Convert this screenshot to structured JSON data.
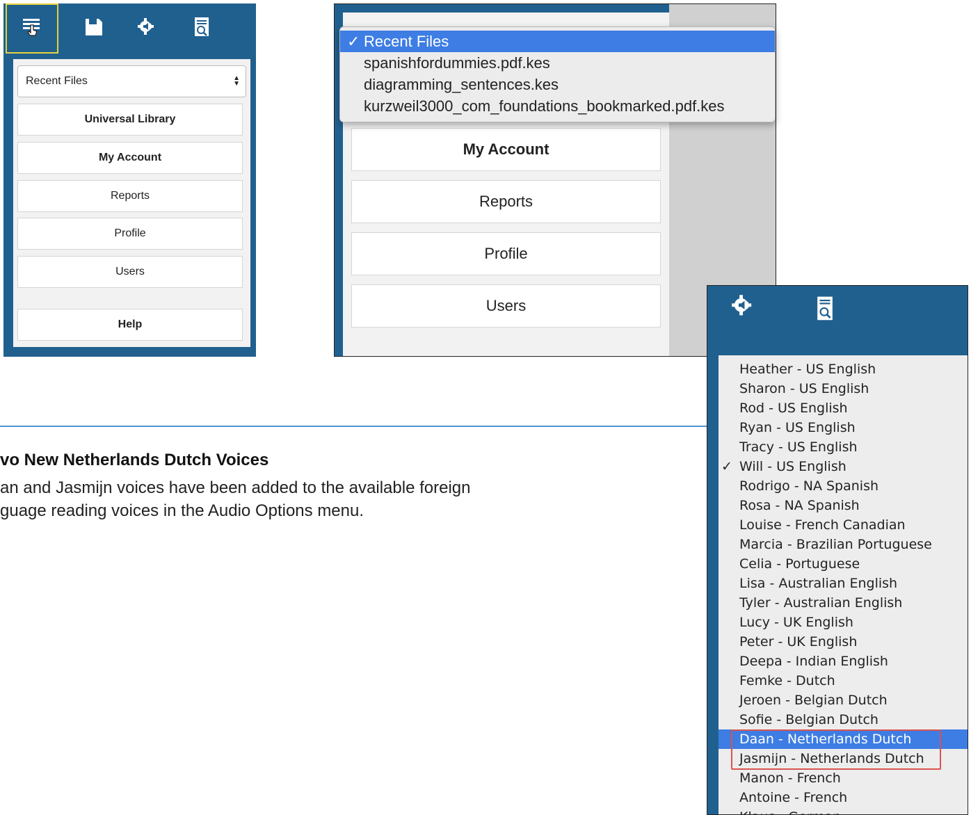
{
  "panel_left": {
    "toolbar": {
      "icons": [
        "menu-icon",
        "save-icon",
        "audio-settings-icon",
        "document-search-icon"
      ]
    },
    "recent_files_select": "Recent Files",
    "buttons": {
      "universal_library": "Universal Library",
      "my_account": "My Account",
      "reports": "Reports",
      "profile": "Profile",
      "users": "Users",
      "help": "Help"
    }
  },
  "panel_zoom": {
    "dropdown": {
      "selected_check": "✓",
      "options": [
        "Recent Files",
        "spanishfordummies.pdf.kes",
        "diagramming_sentences.kes",
        "kurzweil3000_com_foundations_bookmarked.pdf.kes"
      ]
    },
    "buttons": {
      "my_account": "My Account",
      "reports": "Reports",
      "profile": "Profile",
      "users": "Users"
    }
  },
  "section": {
    "heading": "vo New Netherlands Dutch Voices",
    "description_line1": "an and Jasmijn voices have been added to the available foreign",
    "description_line2": "guage reading voices in the Audio Options menu."
  },
  "voice_panel": {
    "toolbar": {
      "icons": [
        "audio-settings-icon",
        "document-search-icon"
      ]
    },
    "check": "✓",
    "voices": [
      "Heather - US English",
      "Sharon - US English",
      "Rod - US English",
      "Ryan - US English",
      "Tracy - US English",
      "Will - US English",
      "Rodrigo - NA Spanish",
      "Rosa - NA Spanish",
      "Louise - French Canadian",
      "Marcia - Brazilian Portuguese",
      "Celia - Portuguese",
      "Lisa - Australian English",
      "Tyler - Australian English",
      "Lucy - UK English",
      "Peter - UK English",
      "Deepa - Indian English",
      "Femke - Dutch",
      "Jeroen - Belgian Dutch",
      "Sofie - Belgian Dutch",
      "Daan - Netherlands Dutch",
      "Jasmijn - Netherlands Dutch",
      "Manon - French",
      "Antoine - French",
      "Klaus - German"
    ],
    "selected_voice": "Will - US English",
    "highlighted_voice": "Daan - Netherlands Dutch"
  },
  "colors": {
    "toolbar_blue": "#20608f",
    "highlight_blue": "#3d7de4",
    "divider_blue": "#4d95d3",
    "annotation_red": "#d9534f",
    "selection_yellow": "#e7d33a"
  }
}
